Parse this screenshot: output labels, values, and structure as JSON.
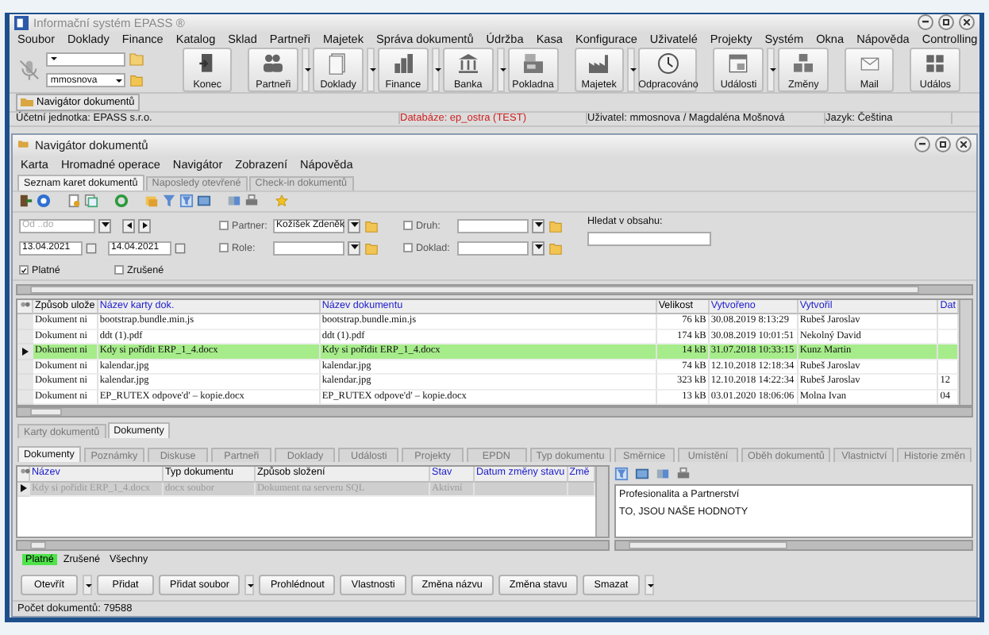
{
  "window": {
    "title": "Informační systém EPASS ®"
  },
  "menu": [
    "Soubor",
    "Doklady",
    "Finance",
    "Katalog",
    "Sklad",
    "Partneři",
    "Majetek",
    "Správa dokumentů",
    "Údržba",
    "Kasa",
    "Konfigurace",
    "Uživatelé",
    "Projekty",
    "Systém",
    "Okna",
    "Nápověda",
    "Controlling"
  ],
  "toolbar": {
    "field_2": {
      "value": "mmosnova"
    },
    "buttons": [
      {
        "label": "Konec",
        "has_dropdown": false
      },
      {
        "label": "Partneři",
        "has_dropdown": true
      },
      {
        "label": "Doklady",
        "has_dropdown": true
      },
      {
        "label": "Finance",
        "has_dropdown": true
      },
      {
        "label": "Banka",
        "has_dropdown": true
      },
      {
        "label": "Pokladna",
        "has_dropdown": false
      },
      {
        "label": "Majetek",
        "has_dropdown": true
      },
      {
        "label": "Odpracováno",
        "has_dropdown": false
      },
      {
        "label": "Události",
        "has_dropdown": true
      },
      {
        "label": "Změny",
        "has_dropdown": false
      },
      {
        "label": "Mail",
        "has_dropdown": false
      },
      {
        "label": "Událos",
        "has_dropdown": false
      }
    ]
  },
  "open_windows": [
    {
      "label": "Navigátor dokumentů"
    }
  ],
  "status_bar": {
    "unit": "Účetní jednotka: EPASS s.r.o.",
    "database": "Databáze: ep_ostra (TEST)",
    "user": "Uživatel: mmosnova / Magdaléna Mošnová",
    "language": "Jazyk: Čeština"
  },
  "navigator": {
    "title": "Navigátor dokumentů",
    "menu": [
      "Karta",
      "Hromadné operace",
      "Navigátor",
      "Zobrazení",
      "Nápověda"
    ],
    "tabs": [
      {
        "label": "Seznam karet dokumentů",
        "selected": true
      },
      {
        "label": "Naposledy otevřené",
        "selected": false
      },
      {
        "label": "Check-in dokumentů",
        "selected": false
      }
    ],
    "filters": {
      "range": {
        "placeholder": "Od ..do"
      },
      "date_from": "13.04.2021",
      "date_to": "14.04.2021",
      "partner": {
        "label": "Partner:",
        "checked": false,
        "value": "Kožíšek Zdeněk"
      },
      "role": {
        "label": "Role:",
        "checked": false
      },
      "druh": {
        "label": "Druh:",
        "checked": false
      },
      "doklad": {
        "label": "Doklad:",
        "checked": false
      },
      "search": {
        "label": "Hledat v obsahu:"
      },
      "valid": {
        "label": "Platné",
        "checked": true
      },
      "cancelled": {
        "label": "Zrušené",
        "checked": false
      }
    },
    "table": {
      "columns": [
        {
          "label": "Způsob ulože",
          "color": "#000000"
        },
        {
          "label": "Název karty dok.",
          "color": "#1a1acc"
        },
        {
          "label": "Název dokumentu",
          "color": "#1a1acc"
        },
        {
          "label": "Velikost",
          "color": "#000000"
        },
        {
          "label": "Vytvořeno",
          "color": "#1a1acc"
        },
        {
          "label": "Vytvořil",
          "color": "#1a1acc"
        },
        {
          "label": "Dat",
          "color": "#1a1acc"
        }
      ],
      "rows": [
        {
          "selected": false,
          "cells": [
            "Dokument ni",
            "bootstrap.bundle.min.js",
            "bootstrap.bundle.min.js",
            "76 kB",
            "30.08.2019 8:13:29",
            "Rubeš Jaroslav",
            ""
          ]
        },
        {
          "selected": false,
          "cells": [
            "Dokument ni",
            "ddt (1).pdf",
            "ddt (1).pdf",
            "174 kB",
            "30.08.2019 10:01:51",
            "Nekolný David",
            ""
          ]
        },
        {
          "selected": true,
          "cells": [
            "Dokument ni",
            "Kdy si pořídit ERP_1_4.docx",
            "Kdy si pořídit ERP_1_4.docx",
            "14 kB",
            "31.07.2018 10:33:15",
            "Kunz Martin",
            ""
          ]
        },
        {
          "selected": false,
          "cells": [
            "Dokument ni",
            "kalendar.jpg",
            "kalendar.jpg",
            "74 kB",
            "12.10.2018 12:18:34",
            "Rubeš Jaroslav",
            ""
          ]
        },
        {
          "selected": false,
          "cells": [
            "Dokument ni",
            "kalendar.jpg",
            "kalendar.jpg",
            "323 kB",
            "12.10.2018 14:22:34",
            "Rubeš Jaroslav",
            "12"
          ]
        },
        {
          "selected": false,
          "cells": [
            "Dokument ni",
            "EP_RUTEX odpove'd' – kopie.docx",
            "EP_RUTEX odpove'd' – kopie.docx",
            "13 kB",
            "03.01.2020 18:06:06",
            "Molna Ivan",
            "04"
          ]
        }
      ]
    },
    "view_tabs": [
      {
        "label": "Karty dokumentů",
        "selected": false
      },
      {
        "label": "Dokumenty",
        "selected": true
      }
    ],
    "detail_tabs": [
      {
        "label": "Dokumenty",
        "selected": true
      },
      {
        "label": "Poznámky",
        "selected": false
      },
      {
        "label": "Diskuse",
        "selected": false
      },
      {
        "label": "Partneři",
        "selected": false
      },
      {
        "label": "Doklady",
        "selected": false
      },
      {
        "label": "Události",
        "selected": false
      },
      {
        "label": "Projekty",
        "selected": false
      },
      {
        "label": "EPDN",
        "selected": false
      },
      {
        "label": "Typ dokumentu",
        "selected": false
      },
      {
        "label": "Směrnice",
        "selected": false
      },
      {
        "label": "Umístění",
        "selected": false
      },
      {
        "label": "Oběh dokumentů",
        "selected": false
      },
      {
        "label": "Vlastnictví",
        "selected": false
      },
      {
        "label": "Historie změn",
        "selected": false
      }
    ],
    "detail_table": {
      "columns": [
        {
          "label": "Název",
          "color": "#1a1acc"
        },
        {
          "label": "Typ dokumentu",
          "color": "#000000"
        },
        {
          "label": "Způsob složení",
          "color": "#000000"
        },
        {
          "label": "Stav",
          "color": "#1a1acc"
        },
        {
          "label": "Datum změny stavu",
          "color": "#1a1acc"
        },
        {
          "label": "Změ",
          "color": "#1a1acc"
        }
      ],
      "rows": [
        {
          "disabled": true,
          "cells": [
            "Kdy si pořídit ERP_1_4.docx",
            "docx soubor",
            "Dokument na serveru SQL",
            "Aktivní",
            "",
            ""
          ]
        }
      ]
    },
    "preview": {
      "lines": [
        "Profesionalita a Partnerství",
        "TO, JSOU NAŠE HODNOTY"
      ]
    },
    "status_filter": [
      {
        "label": "Platné",
        "selected": true
      },
      {
        "label": "Zrušené",
        "selected": false
      },
      {
        "label": "Všechny",
        "selected": false
      }
    ],
    "actions": [
      {
        "label": "Otevřít",
        "has_dropdown": true
      },
      {
        "label": "Přidat",
        "has_dropdown": false
      },
      {
        "label": "Přidat soubor",
        "has_dropdown": true
      },
      {
        "label": "Prohlédnout",
        "has_dropdown": false
      },
      {
        "label": "Vlastnosti",
        "has_dropdown": false
      },
      {
        "label": "Změna názvu",
        "has_dropdown": false
      },
      {
        "label": "Změna stavu",
        "has_dropdown": false
      },
      {
        "label": "Smazat",
        "has_dropdown": true
      }
    ],
    "status_bar": "Počet dokumentů: 79588"
  }
}
